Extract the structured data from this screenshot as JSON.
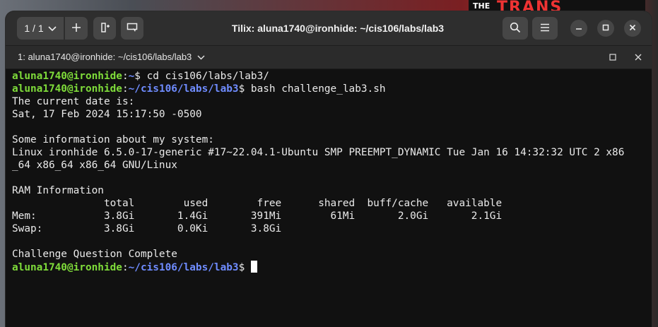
{
  "header": {
    "session_counter": "1 / 1",
    "window_title": "Tilix: aluna1740@ironhide: ~/cis106/labs/lab3"
  },
  "tab": {
    "title": "1: aluna1740@ironhide: ~/cis106/labs/lab3"
  },
  "wallpaper": {
    "logo_small": "THE",
    "logo_big": "TRANS"
  },
  "terminal": {
    "prompt_user": "aluna1740@ironhide",
    "prompt_colon": ":",
    "prompt_dollar": "$",
    "lines": {
      "l1_path": "~",
      "l1_cmd": " cd cis106/labs/lab3/",
      "l2_path": "~/cis106/labs/lab3",
      "l2_cmd": " bash challenge_lab3.sh",
      "l3": "The current date is:",
      "l4": "Sat, 17 Feb 2024 15:17:50 -0500",
      "l5": "",
      "l6": "Some information about my system:",
      "l7": "Linux ironhide 6.5.0-17-generic #17~22.04.1-Ubuntu SMP PREEMPT_DYNAMIC Tue Jan 16 14:32:32 UTC 2 x86",
      "l8": "_64 x86_64 x86_64 GNU/Linux",
      "l9": "",
      "l10": "RAM Information",
      "l11": "               total        used        free      shared  buff/cache   available",
      "l12": "Mem:           3.8Gi       1.4Gi       391Mi        61Mi       2.0Gi       2.1Gi",
      "l13": "Swap:          3.8Gi       0.0Ki       3.8Gi",
      "l14": "",
      "l15": "Challenge Question Complete",
      "l16_path": "~/cis106/labs/lab3",
      "l16_cmd": " "
    }
  },
  "colors": {
    "prompt_user": "#7fdc3a",
    "prompt_path": "#6f8cff",
    "terminal_bg": "#111111",
    "headerbar_bg": "#2e2e2e"
  }
}
